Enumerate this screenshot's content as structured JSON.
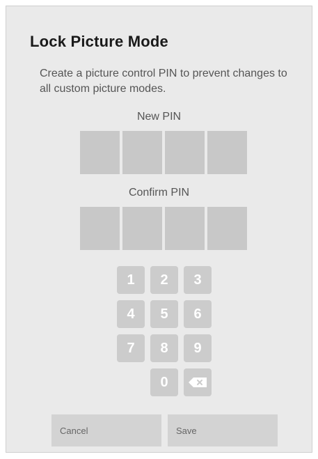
{
  "dialog": {
    "title": "Lock Picture Mode",
    "description": "Create a picture control PIN to prevent changes to all custom picture modes.",
    "new_pin_label": "New PIN",
    "confirm_pin_label": "Confirm PIN"
  },
  "keypad": {
    "keys": [
      "1",
      "2",
      "3",
      "4",
      "5",
      "6",
      "7",
      "8",
      "9",
      "0"
    ],
    "backspace_icon": "backspace-icon"
  },
  "buttons": {
    "cancel_label": "Cancel",
    "save_label": "Save"
  },
  "colors": {
    "panel_background": "#eaeaea",
    "pin_box": "#c8c8c8",
    "key_background": "#cccccc",
    "button_background": "#d3d3d3"
  }
}
